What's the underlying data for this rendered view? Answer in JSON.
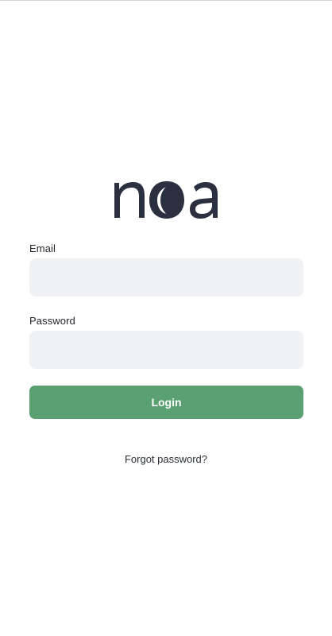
{
  "brand": {
    "logo_text": "noa",
    "logo_color": "#2a3040",
    "accent_color": "#5aa072"
  },
  "form": {
    "email_label": "Email",
    "email_value": "",
    "email_placeholder": "",
    "password_label": "Password",
    "password_value": "",
    "password_placeholder": "",
    "login_label": "Login",
    "forgot_label": "Forgot password?"
  }
}
